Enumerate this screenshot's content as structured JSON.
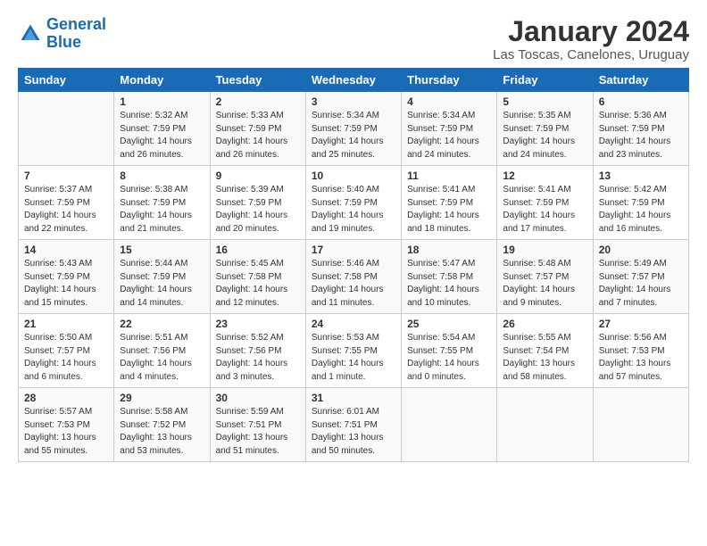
{
  "logo": {
    "text_general": "General",
    "text_blue": "Blue"
  },
  "title": "January 2024",
  "subtitle": "Las Toscas, Canelones, Uruguay",
  "headers": [
    "Sunday",
    "Monday",
    "Tuesday",
    "Wednesday",
    "Thursday",
    "Friday",
    "Saturday"
  ],
  "weeks": [
    [
      {
        "day": "",
        "info": ""
      },
      {
        "day": "1",
        "info": "Sunrise: 5:32 AM\nSunset: 7:59 PM\nDaylight: 14 hours\nand 26 minutes."
      },
      {
        "day": "2",
        "info": "Sunrise: 5:33 AM\nSunset: 7:59 PM\nDaylight: 14 hours\nand 26 minutes."
      },
      {
        "day": "3",
        "info": "Sunrise: 5:34 AM\nSunset: 7:59 PM\nDaylight: 14 hours\nand 25 minutes."
      },
      {
        "day": "4",
        "info": "Sunrise: 5:34 AM\nSunset: 7:59 PM\nDaylight: 14 hours\nand 24 minutes."
      },
      {
        "day": "5",
        "info": "Sunrise: 5:35 AM\nSunset: 7:59 PM\nDaylight: 14 hours\nand 24 minutes."
      },
      {
        "day": "6",
        "info": "Sunrise: 5:36 AM\nSunset: 7:59 PM\nDaylight: 14 hours\nand 23 minutes."
      }
    ],
    [
      {
        "day": "7",
        "info": "Sunrise: 5:37 AM\nSunset: 7:59 PM\nDaylight: 14 hours\nand 22 minutes."
      },
      {
        "day": "8",
        "info": "Sunrise: 5:38 AM\nSunset: 7:59 PM\nDaylight: 14 hours\nand 21 minutes."
      },
      {
        "day": "9",
        "info": "Sunrise: 5:39 AM\nSunset: 7:59 PM\nDaylight: 14 hours\nand 20 minutes."
      },
      {
        "day": "10",
        "info": "Sunrise: 5:40 AM\nSunset: 7:59 PM\nDaylight: 14 hours\nand 19 minutes."
      },
      {
        "day": "11",
        "info": "Sunrise: 5:41 AM\nSunset: 7:59 PM\nDaylight: 14 hours\nand 18 minutes."
      },
      {
        "day": "12",
        "info": "Sunrise: 5:41 AM\nSunset: 7:59 PM\nDaylight: 14 hours\nand 17 minutes."
      },
      {
        "day": "13",
        "info": "Sunrise: 5:42 AM\nSunset: 7:59 PM\nDaylight: 14 hours\nand 16 minutes."
      }
    ],
    [
      {
        "day": "14",
        "info": "Sunrise: 5:43 AM\nSunset: 7:59 PM\nDaylight: 14 hours\nand 15 minutes."
      },
      {
        "day": "15",
        "info": "Sunrise: 5:44 AM\nSunset: 7:59 PM\nDaylight: 14 hours\nand 14 minutes."
      },
      {
        "day": "16",
        "info": "Sunrise: 5:45 AM\nSunset: 7:58 PM\nDaylight: 14 hours\nand 12 minutes."
      },
      {
        "day": "17",
        "info": "Sunrise: 5:46 AM\nSunset: 7:58 PM\nDaylight: 14 hours\nand 11 minutes."
      },
      {
        "day": "18",
        "info": "Sunrise: 5:47 AM\nSunset: 7:58 PM\nDaylight: 14 hours\nand 10 minutes."
      },
      {
        "day": "19",
        "info": "Sunrise: 5:48 AM\nSunset: 7:57 PM\nDaylight: 14 hours\nand 9 minutes."
      },
      {
        "day": "20",
        "info": "Sunrise: 5:49 AM\nSunset: 7:57 PM\nDaylight: 14 hours\nand 7 minutes."
      }
    ],
    [
      {
        "day": "21",
        "info": "Sunrise: 5:50 AM\nSunset: 7:57 PM\nDaylight: 14 hours\nand 6 minutes."
      },
      {
        "day": "22",
        "info": "Sunrise: 5:51 AM\nSunset: 7:56 PM\nDaylight: 14 hours\nand 4 minutes."
      },
      {
        "day": "23",
        "info": "Sunrise: 5:52 AM\nSunset: 7:56 PM\nDaylight: 14 hours\nand 3 minutes."
      },
      {
        "day": "24",
        "info": "Sunrise: 5:53 AM\nSunset: 7:55 PM\nDaylight: 14 hours\nand 1 minute."
      },
      {
        "day": "25",
        "info": "Sunrise: 5:54 AM\nSunset: 7:55 PM\nDaylight: 14 hours\nand 0 minutes."
      },
      {
        "day": "26",
        "info": "Sunrise: 5:55 AM\nSunset: 7:54 PM\nDaylight: 13 hours\nand 58 minutes."
      },
      {
        "day": "27",
        "info": "Sunrise: 5:56 AM\nSunset: 7:53 PM\nDaylight: 13 hours\nand 57 minutes."
      }
    ],
    [
      {
        "day": "28",
        "info": "Sunrise: 5:57 AM\nSunset: 7:53 PM\nDaylight: 13 hours\nand 55 minutes."
      },
      {
        "day": "29",
        "info": "Sunrise: 5:58 AM\nSunset: 7:52 PM\nDaylight: 13 hours\nand 53 minutes."
      },
      {
        "day": "30",
        "info": "Sunrise: 5:59 AM\nSunset: 7:51 PM\nDaylight: 13 hours\nand 51 minutes."
      },
      {
        "day": "31",
        "info": "Sunrise: 6:01 AM\nSunset: 7:51 PM\nDaylight: 13 hours\nand 50 minutes."
      },
      {
        "day": "",
        "info": ""
      },
      {
        "day": "",
        "info": ""
      },
      {
        "day": "",
        "info": ""
      }
    ]
  ]
}
